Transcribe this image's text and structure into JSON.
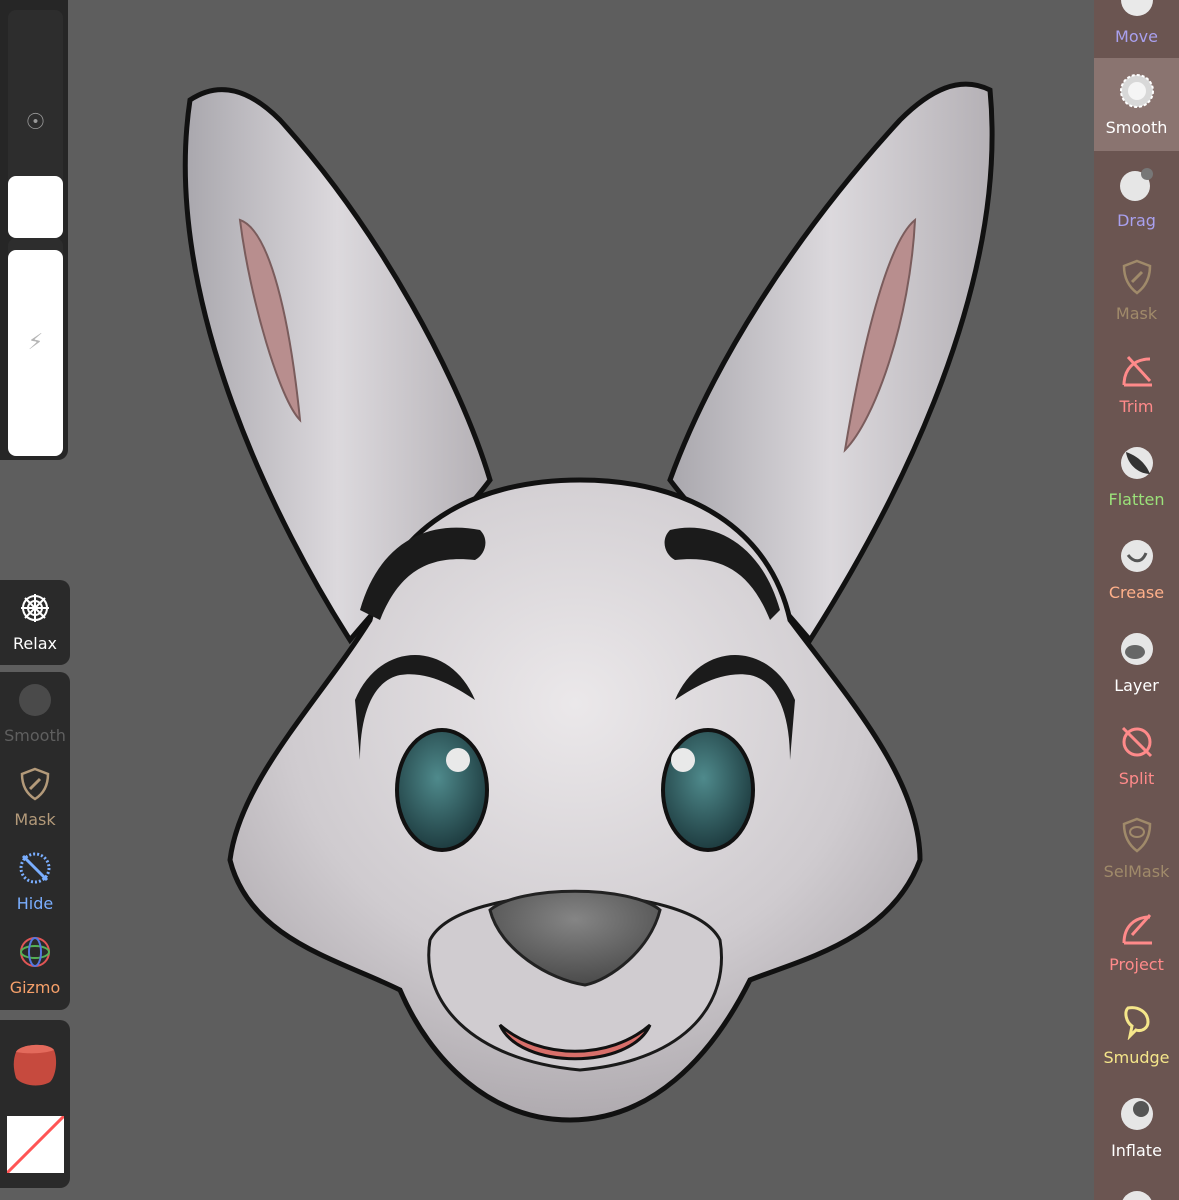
{
  "left_tools": [
    {
      "label": "Relax",
      "color": "#ffffff",
      "icon": "web-icon"
    },
    {
      "label": "Smooth",
      "color": "#5f5f5f",
      "icon": "smooth-ball-icon"
    },
    {
      "label": "Mask",
      "color": "#b39a7a",
      "icon": "mask-shield-icon"
    },
    {
      "label": "Hide",
      "color": "#7aaeff",
      "icon": "hide-dots-icon"
    },
    {
      "label": "Gizmo",
      "color": "#f6a06a",
      "icon": "gizmo-icon"
    }
  ],
  "right_tools": [
    {
      "label": "Move",
      "color": "#a9a0ee",
      "icon": "move-ball-icon"
    },
    {
      "label": "Smooth",
      "color": "#ffffff",
      "icon": "smooth-ball-icon",
      "active": true
    },
    {
      "label": "Drag",
      "color": "#a9a0ee",
      "icon": "drag-ball-icon"
    },
    {
      "label": "Mask",
      "color": "#a08a6a",
      "icon": "mask-shield-icon"
    },
    {
      "label": "Trim",
      "color": "#ff8a8a",
      "icon": "trim-icon"
    },
    {
      "label": "Flatten",
      "color": "#9be27a",
      "icon": "flatten-ball-icon"
    },
    {
      "label": "Crease",
      "color": "#ffb08a",
      "icon": "crease-ball-icon"
    },
    {
      "label": "Layer",
      "color": "#ffffff",
      "icon": "layer-ball-icon"
    },
    {
      "label": "Split",
      "color": "#ff8a8a",
      "icon": "split-icon"
    },
    {
      "label": "SelMask",
      "color": "#a08a6a",
      "icon": "selmask-icon"
    },
    {
      "label": "Project",
      "color": "#ff8a8a",
      "icon": "project-icon"
    },
    {
      "label": "Smudge",
      "color": "#f5e68a",
      "icon": "smudge-icon"
    },
    {
      "label": "Inflate",
      "color": "#ffffff",
      "icon": "inflate-ball-icon"
    }
  ]
}
